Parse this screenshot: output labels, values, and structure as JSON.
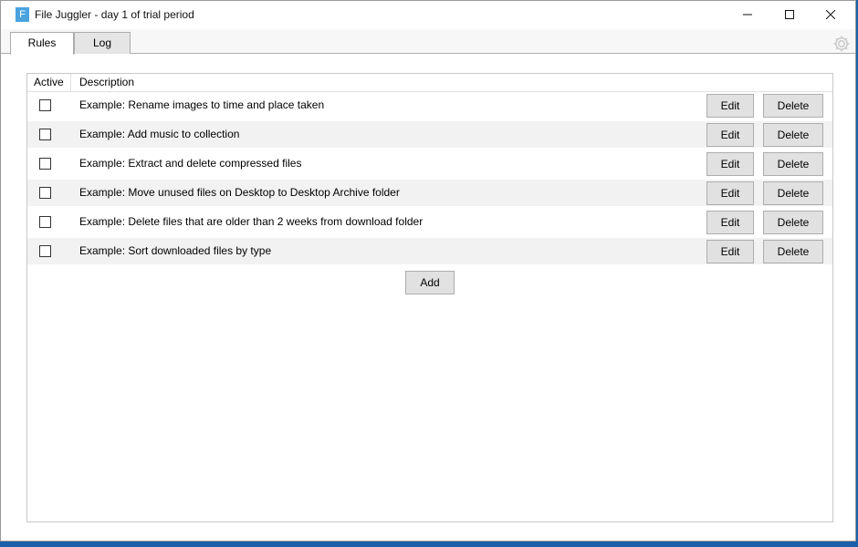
{
  "window": {
    "title": "File Juggler - day 1 of trial period",
    "icon_letter": "F",
    "accent": "#4aa3df"
  },
  "tabs": [
    {
      "label": "Rules",
      "selected": true
    },
    {
      "label": "Log",
      "selected": false
    }
  ],
  "settings_icon": "gear-icon",
  "table": {
    "headers": {
      "active": "Active",
      "description": "Description"
    },
    "rows": [
      {
        "active": false,
        "description": "Example: Rename images to time and place taken",
        "edit_label": "Edit",
        "delete_label": "Delete"
      },
      {
        "active": false,
        "description": "Example: Add music to collection",
        "edit_label": "Edit",
        "delete_label": "Delete"
      },
      {
        "active": false,
        "description": "Example: Extract and delete compressed files",
        "edit_label": "Edit",
        "delete_label": "Delete"
      },
      {
        "active": false,
        "description": "Example: Move unused files on Desktop to Desktop Archive folder",
        "edit_label": "Edit",
        "delete_label": "Delete"
      },
      {
        "active": false,
        "description": "Example: Delete files that are older than 2 weeks from download folder",
        "edit_label": "Edit",
        "delete_label": "Delete"
      },
      {
        "active": false,
        "description": "Example: Sort downloaded files by type",
        "edit_label": "Edit",
        "delete_label": "Delete"
      }
    ]
  },
  "add_label": "Add"
}
